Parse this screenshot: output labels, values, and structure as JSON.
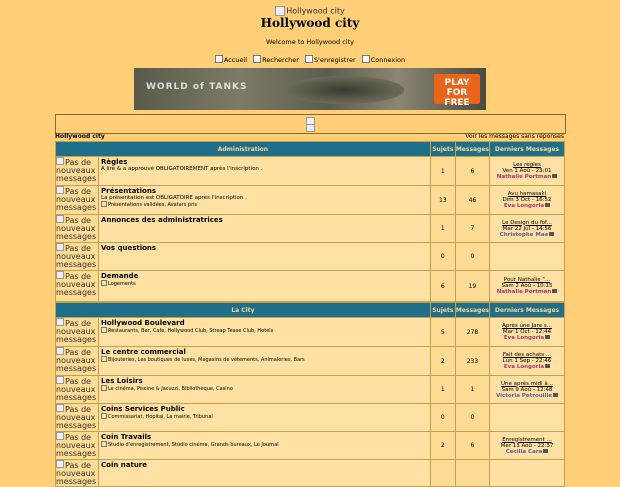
{
  "header": {
    "logo_alt": "Hollywood city",
    "title": "Hollywood city",
    "welcome": "Welcome to Hollywood city"
  },
  "nav": [
    {
      "label": "Accueil"
    },
    {
      "label": "Rechercher"
    },
    {
      "label": "S'enregistrer"
    },
    {
      "label": "Connexion"
    }
  ],
  "banner": {
    "brand": "WORLD of TANKS",
    "cta": "PLAY FOR FREE"
  },
  "bar": {
    "left": "Hollywood city",
    "right": "Voir les messages sans réponses"
  },
  "icon_alt": "Pas de nouveaux messages",
  "categories": [
    {
      "title": "Administration",
      "col_topics": "Sujets",
      "col_posts": "Messages",
      "col_last": "Derniers Messages",
      "forums": [
        {
          "name": "Règles",
          "desc": "A lire & a approuvé OBLIGATOIREMENT après l'inscription .",
          "subs": "",
          "topics": "1",
          "posts": "6",
          "last_title": "Les règles",
          "last_date": "Ven 1 Aoû - 23:01",
          "last_author": "Nathalie Portman",
          "author_color": "#b0306e"
        },
        {
          "name": "Présentations",
          "desc": "La présentation est OBLIGATOIRE après l'inscription .",
          "subs": "Présentations validées, Avatars pris",
          "topics": "13",
          "posts": "46",
          "last_title": "Avu hamasaki",
          "last_date": "Dim 3 Oct - 16:52",
          "last_author": "Eva Longoria",
          "author_color": "#b0306e"
        },
        {
          "name": "Annonces des administratrices",
          "desc": "",
          "subs": "",
          "topics": "1",
          "posts": "7",
          "last_title": "Le Design du fof...",
          "last_date": "Mar 22 Jul - 14:56",
          "last_author": "Christophe Mae",
          "author_color": "#5a5aa0"
        },
        {
          "name": "Vos questions",
          "desc": "",
          "subs": "",
          "topics": "0",
          "posts": "0",
          "last_title": "",
          "last_date": "",
          "last_author": "",
          "author_color": "#000"
        },
        {
          "name": "Demande",
          "desc": "",
          "subs": "Logements",
          "topics": "6",
          "posts": "19",
          "last_title": "Pour Nathalie \"...",
          "last_date": "Sam 2 Aoû - 10:15",
          "last_author": "Nathalie Portman",
          "author_color": "#b0306e"
        }
      ]
    },
    {
      "title": "La City",
      "col_topics": "Sujets",
      "col_posts": "Messages",
      "col_last": "Derniers Messages",
      "forums": [
        {
          "name": "Hollywood Boulevard",
          "desc": "",
          "subs": "Restaurants, Bar, Cafe, Hollywood Club, Streap Tease Club, Hotels",
          "topics": "5",
          "posts": "278",
          "last_title": "Après une Jare s...",
          "last_date": "Mar 1 Oct - 12:44",
          "last_author": "Eva Longoria",
          "author_color": "#b0306e"
        },
        {
          "name": "Le centre commercial",
          "desc": "",
          "subs": "Bijouteries, Les boutiques de luxes, Magasins de vêtements, Animaleries, Bars",
          "topics": "2",
          "posts": "233",
          "last_title": "Fait des achats ...",
          "last_date": "Lun 1 Sep - 22:46",
          "last_author": "Eva Longoria",
          "author_color": "#b0306e"
        },
        {
          "name": "Les Loisirs",
          "desc": "",
          "subs": "Le cinéma, Piscine & Jacuzzi, Bibliothèque, Casino",
          "topics": "1",
          "posts": "1",
          "last_title": "Une aprés midi à...",
          "last_date": "Sam 9 Aoû - 12:48",
          "last_author": "Victoria Petrouille",
          "author_color": "#5a5aa0"
        },
        {
          "name": "Coins Services Public",
          "desc": "",
          "subs": "Commissariat, Hopital, La mairie, Tribunal",
          "topics": "0",
          "posts": "0",
          "last_title": "",
          "last_date": "",
          "last_author": "",
          "author_color": "#000"
        },
        {
          "name": "Coin Travails",
          "desc": "",
          "subs": "Studio d'enregistrement, Studio cinéma, Grands bureaux, Le Journal",
          "topics": "2",
          "posts": "6",
          "last_title": "Enregistrement ...",
          "last_date": "Mer 13 Aoû - 22:37",
          "last_author": "Cecilia Cara",
          "author_color": "#5a5aa0"
        },
        {
          "name": "Coin nature",
          "desc": "",
          "subs": "",
          "topics": "",
          "posts": "",
          "last_title": "",
          "last_date": "",
          "last_author": "",
          "author_color": "#000"
        }
      ]
    }
  ]
}
